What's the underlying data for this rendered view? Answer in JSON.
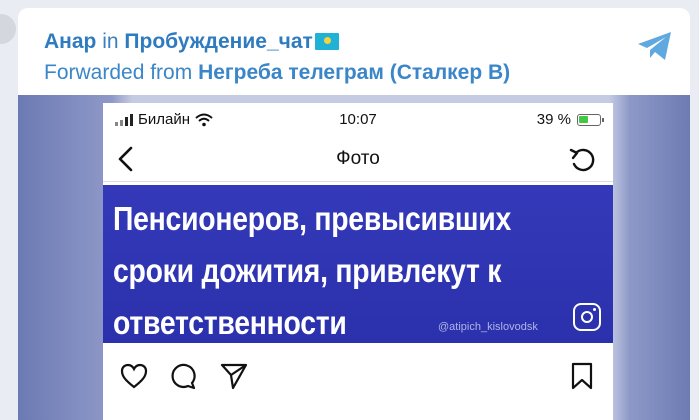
{
  "message": {
    "sender": "Анар",
    "in_word": "in",
    "chat": "Пробуждение_чат",
    "flag_icon": "kazakhstan-flag-icon",
    "forwarded_prefix": "Forwarded from",
    "forwarded_source": "Негреба телеграм (Сталкер В)",
    "share_icon": "telegram-share-icon"
  },
  "phone": {
    "carrier": "Билайн",
    "time": "10:07",
    "battery": "39 %",
    "nav_title": "Фото"
  },
  "post": {
    "headline_lines": [
      "Пенсионеров, превысивших",
      "сроки дожития, привлекут к",
      "ответственности"
    ],
    "watermark": "@atipich_kislovodsk"
  },
  "colors": {
    "link_blue": "#2f7bc0",
    "banner_blue": "#2e34b4"
  }
}
